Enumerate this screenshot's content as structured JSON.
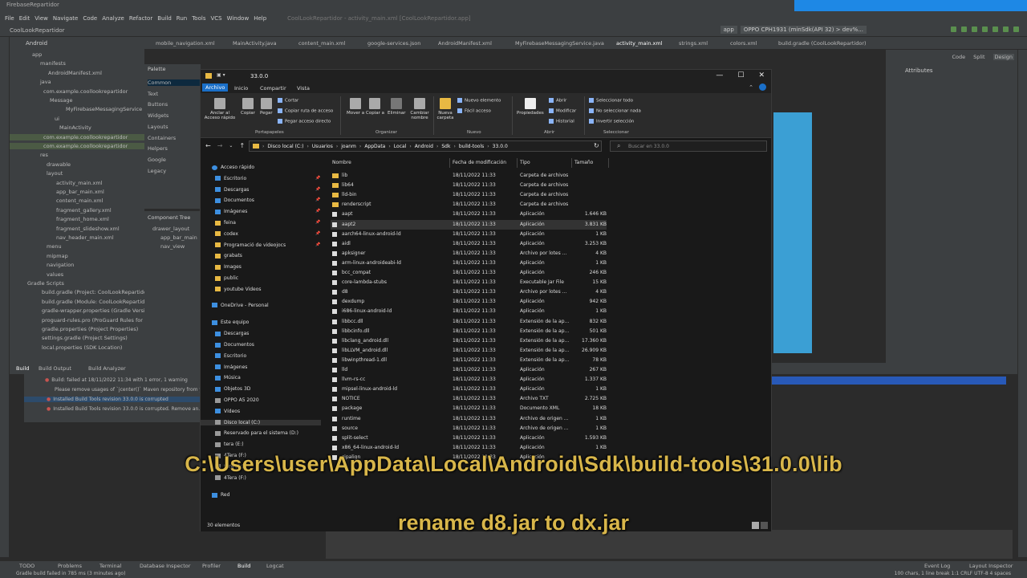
{
  "ide": {
    "title": "FirebaseRepartidor",
    "menu": [
      "File",
      "Edit",
      "View",
      "Navigate",
      "Code",
      "Analyze",
      "Refactor",
      "Build",
      "Run",
      "Tools",
      "VCS",
      "Window",
      "Help"
    ],
    "window_title": "CoolLookRepartidor - activity_main.xml [CoolLookRepartidor.app]",
    "breadcrumb": "CoolLookRepartidor",
    "run_config": [
      "app",
      "OPPO CPH1931 (minSdk(API 32) > dev%..."
    ],
    "project_view": "Android",
    "editor_tabs": [
      "mobile_navigation.xml",
      "MainActivity.java",
      "content_main.xml",
      "google-services.json",
      "AndroidManifest.xml",
      "MyFirebaseMessagingService.java",
      "activity_main.xml",
      "strings.xml",
      "colors.xml",
      "build.gradle (CoolLookRepartidor)"
    ],
    "project_tree": [
      "app",
      "manifests",
      "AndroidManifest.xml",
      "java",
      "com.example.coollookrepartidor",
      "Message",
      "MyFirebaseMessagingService",
      "ui",
      "MainActivity",
      "com.example.coollookrepartidor",
      "com.example.coollookrepartidor",
      "res",
      "drawable",
      "layout",
      "activity_main.xml",
      "app_bar_main.xml",
      "content_main.xml",
      "fragment_gallery.xml",
      "fragment_home.xml",
      "fragment_slideshow.xml",
      "nav_header_main.xml",
      "menu",
      "mipmap",
      "navigation",
      "values",
      "Gradle Scripts",
      "build.gradle (Project: CoolLookRepartidor)",
      "build.gradle (Module: CoolLookRepartidor)",
      "gradle-wrapper.properties (Gradle Version)",
      "proguard-rules.pro (ProGuard Rules for CoolLook)",
      "gradle.properties (Project Properties)",
      "settings.gradle (Project Settings)",
      "local.properties (SDK Location)"
    ],
    "palette": {
      "title": "Palette",
      "items": [
        "Common",
        "Text",
        "Buttons",
        "Widgets",
        "Layouts",
        "Containers",
        "Helpers",
        "Google",
        "Legacy"
      ]
    },
    "component_tree": {
      "title": "Component Tree",
      "items": [
        "drawer_layout",
        "app_bar_main",
        "nav_view"
      ]
    },
    "design_modes": [
      "Code",
      "Split",
      "Design"
    ],
    "attributes_title": "Attributes",
    "build": {
      "tabs": [
        "Build",
        "Build Output",
        "Build Analyzer"
      ],
      "lines": [
        "Build: failed at 18/11/2022 11:34 with 1 error, 1 warning",
        "Please remove usages of `jcenter()` Maven repository from yo...",
        "Installed Build Tools revision 33.0.0 is corrupted",
        "Installed Build Tools revision 33.0.0 is corrupted. Remove an..."
      ]
    },
    "bottom_tools": [
      "TODO",
      "Problems",
      "Terminal",
      "Database Inspector",
      "Profiler",
      "Build",
      "Logcat",
      "Event Log",
      "Layout Inspector"
    ],
    "status": {
      "left": "Gradle build failed in 785 ms (3 minutes ago)",
      "right": "100 chars, 1 line break   1:1   CRLF   UTF-8   4 spaces"
    }
  },
  "explorer": {
    "title": "33.0.0",
    "ribbon_tabs": [
      "Archivo",
      "Inicio",
      "Compartir",
      "Vista"
    ],
    "ribbon": {
      "pin": "Anclar al Acceso rápido",
      "copy": "Copiar",
      "paste": "Pegar",
      "cut": "Cortar",
      "copy_path": "Copiar ruta de acceso",
      "paste_shortcut": "Pegar acceso directo",
      "move": "Mover a",
      "copy_to": "Copiar a",
      "delete": "Eliminar",
      "rename": "Cambiar nombre",
      "new_folder": "Nueva carpeta",
      "new_item": "Nuevo elemento",
      "easy_access": "Fácil acceso",
      "properties": "Propiedades",
      "open": "Abrir",
      "edit": "Modificar",
      "history": "Historial",
      "select_all": "Seleccionar todo",
      "select_none": "No seleccionar nada",
      "invert": "Invertir selección",
      "groups": [
        "Portapapeles",
        "Organizar",
        "Nuevo",
        "Abrir",
        "Seleccionar"
      ]
    },
    "path": [
      "Disco local (C:)",
      "Usuarios",
      "joanm",
      "AppData",
      "Local",
      "Android",
      "Sdk",
      "build-tools",
      "33.0.0"
    ],
    "search_placeholder": "Buscar en 33.0.0",
    "nav": [
      {
        "label": "Acceso rápido",
        "icon": "star"
      },
      {
        "label": "Escritorio",
        "icon": "blue",
        "pin": true
      },
      {
        "label": "Descargas",
        "icon": "blue",
        "pin": true
      },
      {
        "label": "Documentos",
        "icon": "blue",
        "pin": true
      },
      {
        "label": "Imágenes",
        "icon": "blue",
        "pin": true
      },
      {
        "label": "feina",
        "icon": "yellow",
        "pin": true
      },
      {
        "label": "codex",
        "icon": "yellow",
        "pin": true
      },
      {
        "label": "Programació de videojocs",
        "icon": "yellow",
        "pin": true
      },
      {
        "label": "grabats",
        "icon": "yellow"
      },
      {
        "label": "Images",
        "icon": "yellow"
      },
      {
        "label": "public",
        "icon": "yellow"
      },
      {
        "label": "youtube Videos",
        "icon": "yellow"
      },
      {
        "label": "OneDrive - Personal",
        "icon": "blue"
      },
      {
        "label": "Este equipo",
        "icon": "blue"
      },
      {
        "label": "Descargas",
        "icon": "blue"
      },
      {
        "label": "Documentos",
        "icon": "blue"
      },
      {
        "label": "Escritorio",
        "icon": "blue"
      },
      {
        "label": "Imágenes",
        "icon": "blue"
      },
      {
        "label": "Música",
        "icon": "blue"
      },
      {
        "label": "Objetos 3D",
        "icon": "blue"
      },
      {
        "label": "OPPO A5 2020",
        "icon": "grey"
      },
      {
        "label": "Vídeos",
        "icon": "blue"
      },
      {
        "label": "Disco local (C:)",
        "icon": "grey"
      },
      {
        "label": "Reservado para el sistema (D:)",
        "icon": "grey"
      },
      {
        "label": "tera (E:)",
        "icon": "grey"
      },
      {
        "label": "4Tera (F:)",
        "icon": "grey"
      },
      {
        "label": "tera (E:)",
        "icon": "grey"
      },
      {
        "label": "4Tera (F:)",
        "icon": "grey"
      },
      {
        "label": "Red",
        "icon": "blue"
      }
    ],
    "columns": [
      "Nombre",
      "Fecha de modificación",
      "Tipo",
      "Tamaño"
    ],
    "files": [
      {
        "name": "lib",
        "date": "18/11/2022 11:33",
        "type": "Carpeta de archivos",
        "size": "",
        "folder": true
      },
      {
        "name": "lib64",
        "date": "18/11/2022 11:33",
        "type": "Carpeta de archivos",
        "size": "",
        "folder": true
      },
      {
        "name": "lld-bin",
        "date": "18/11/2022 11:33",
        "type": "Carpeta de archivos",
        "size": "",
        "folder": true
      },
      {
        "name": "renderscript",
        "date": "18/11/2022 11:33",
        "type": "Carpeta de archivos",
        "size": "",
        "folder": true
      },
      {
        "name": "aapt",
        "date": "18/11/2022 11:33",
        "type": "Aplicación",
        "size": "1.646 KB"
      },
      {
        "name": "aapt2",
        "date": "18/11/2022 11:33",
        "type": "Aplicación",
        "size": "3.831 KB",
        "hl": true
      },
      {
        "name": "aarch64-linux-android-ld",
        "date": "18/11/2022 11:33",
        "type": "Aplicación",
        "size": "1 KB"
      },
      {
        "name": "aidl",
        "date": "18/11/2022 11:33",
        "type": "Aplicación",
        "size": "3.253 KB"
      },
      {
        "name": "apksigner",
        "date": "18/11/2022 11:33",
        "type": "Archivo por lotes ...",
        "size": "4 KB"
      },
      {
        "name": "arm-linux-androideabi-ld",
        "date": "18/11/2022 11:33",
        "type": "Aplicación",
        "size": "1 KB"
      },
      {
        "name": "bcc_compat",
        "date": "18/11/2022 11:33",
        "type": "Aplicación",
        "size": "246 KB"
      },
      {
        "name": "core-lambda-stubs",
        "date": "18/11/2022 11:33",
        "type": "Executable Jar File",
        "size": "15 KB"
      },
      {
        "name": "d8",
        "date": "18/11/2022 11:33",
        "type": "Archivo por lotes ...",
        "size": "4 KB"
      },
      {
        "name": "dexdump",
        "date": "18/11/2022 11:33",
        "type": "Aplicación",
        "size": "942 KB"
      },
      {
        "name": "i686-linux-android-ld",
        "date": "18/11/2022 11:33",
        "type": "Aplicación",
        "size": "1 KB"
      },
      {
        "name": "libbcc.dll",
        "date": "18/11/2022 11:33",
        "type": "Extensión de la ap...",
        "size": "832 KB"
      },
      {
        "name": "libbcinfo.dll",
        "date": "18/11/2022 11:33",
        "type": "Extensión de la ap...",
        "size": "501 KB"
      },
      {
        "name": "libclang_android.dll",
        "date": "18/11/2022 11:33",
        "type": "Extensión de la ap...",
        "size": "17.360 KB"
      },
      {
        "name": "libLLVM_android.dll",
        "date": "18/11/2022 11:33",
        "type": "Extensión de la ap...",
        "size": "26.909 KB"
      },
      {
        "name": "libwinpthread-1.dll",
        "date": "18/11/2022 11:33",
        "type": "Extensión de la ap...",
        "size": "78 KB"
      },
      {
        "name": "lld",
        "date": "18/11/2022 11:33",
        "type": "Aplicación",
        "size": "267 KB"
      },
      {
        "name": "llvm-rs-cc",
        "date": "18/11/2022 11:33",
        "type": "Aplicación",
        "size": "1.337 KB"
      },
      {
        "name": "mipsel-linux-android-ld",
        "date": "18/11/2022 11:33",
        "type": "Aplicación",
        "size": "1 KB"
      },
      {
        "name": "NOTICE",
        "date": "18/11/2022 11:33",
        "type": "Archivo TXT",
        "size": "2.725 KB"
      },
      {
        "name": "package",
        "date": "18/11/2022 11:33",
        "type": "Documento XML",
        "size": "18 KB"
      },
      {
        "name": "runtime",
        "date": "18/11/2022 11:33",
        "type": "Archivo de origen ...",
        "size": "1 KB"
      },
      {
        "name": "source",
        "date": "18/11/2022 11:33",
        "type": "Archivo de origen ...",
        "size": "1 KB"
      },
      {
        "name": "split-select",
        "date": "18/11/2022 11:33",
        "type": "Aplicación",
        "size": "1.593 KB"
      },
      {
        "name": "x86_64-linux-android-ld",
        "date": "18/11/2022 11:33",
        "type": "Aplicación",
        "size": "1 KB"
      },
      {
        "name": "zipalign",
        "date": "18/11/2022 11:33",
        "type": "Aplicación",
        "size": "",
        "cut": true
      }
    ],
    "status": "30 elementos"
  },
  "captions": {
    "line1": "C:\\Users\\user\\AppData\\Local\\Android\\Sdk\\build-tools\\31.0.0\\lib",
    "line2": "rename d8.jar to dx.jar"
  }
}
